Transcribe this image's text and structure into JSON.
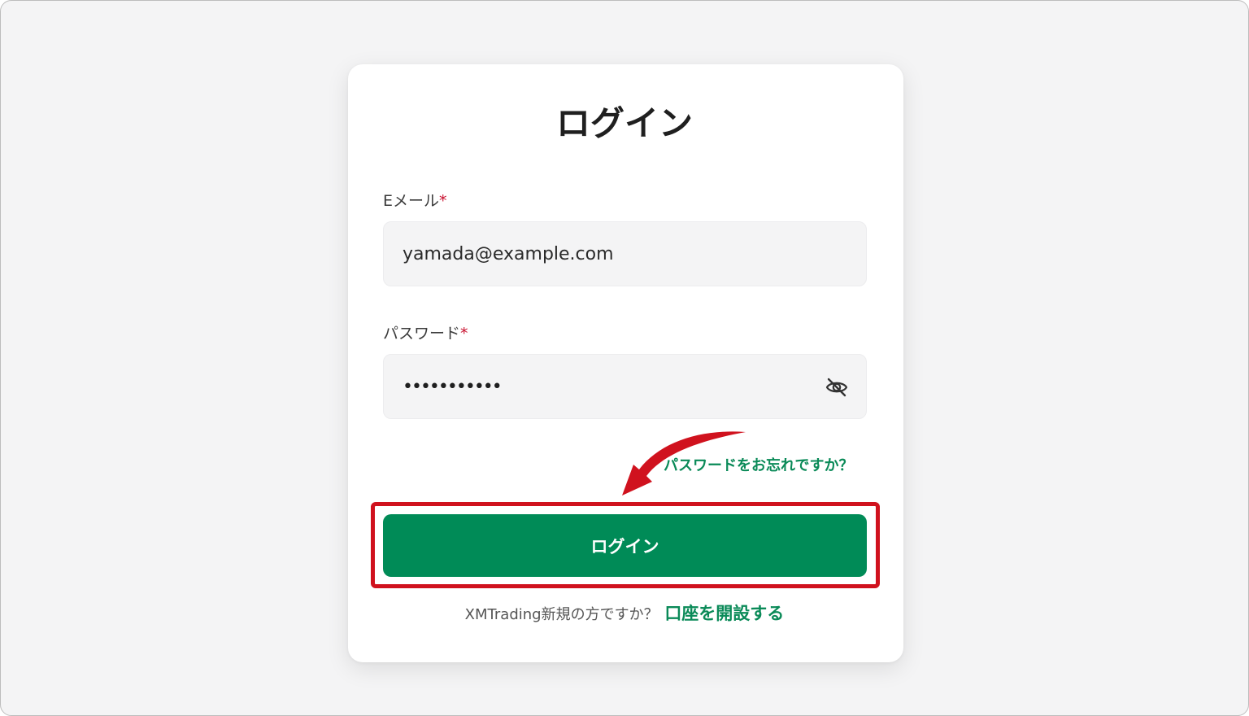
{
  "login_form": {
    "title": "ログイン",
    "email": {
      "label": "Eメール",
      "required_mark": "*",
      "value": "yamada@example.com"
    },
    "password": {
      "label": "パスワード",
      "required_mark": "*",
      "masked_value": "•••••••••••",
      "visibility_icon": "eye-slash-icon"
    },
    "forgot_password_link": "パスワードをお忘れですか？",
    "submit_label": "ログイン",
    "signup_prompt": "XMTrading新規の方ですか？",
    "signup_link": "口座を開設する"
  },
  "annotation": {
    "arrow_icon": "curved-arrow-icon",
    "highlight_color": "#d0121e"
  },
  "colors": {
    "accent_green": "#008b57",
    "link_green": "#0a8a58",
    "required_red": "#c8102e"
  }
}
